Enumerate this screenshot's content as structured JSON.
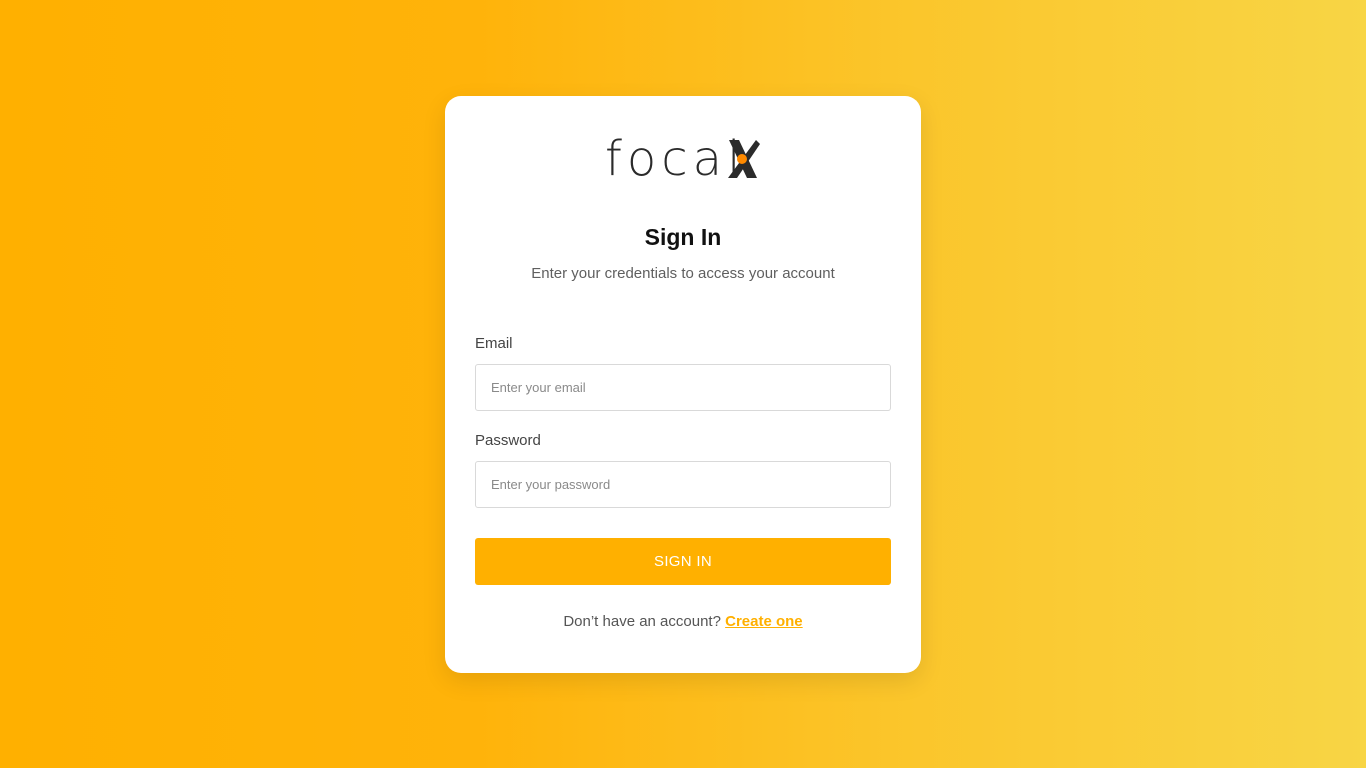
{
  "colors": {
    "accent": "#ffb000",
    "background_start": "#ffb000",
    "background_end": "#f8d545",
    "card": "#ffffff",
    "logo_dot": "#ff8a00"
  },
  "logo": {
    "text": "focal",
    "mark": "X",
    "icon": "focalx-logo-icon"
  },
  "header": {
    "title": "Sign In",
    "subtitle": "Enter your credentials to access your account"
  },
  "form": {
    "email": {
      "label": "Email",
      "placeholder": "Enter your email",
      "value": ""
    },
    "password": {
      "label": "Password",
      "placeholder": "Enter your password",
      "value": ""
    },
    "submit_label": "SIGN IN"
  },
  "footer": {
    "prompt": "Don’t have an account?",
    "link_label": "Create one"
  }
}
